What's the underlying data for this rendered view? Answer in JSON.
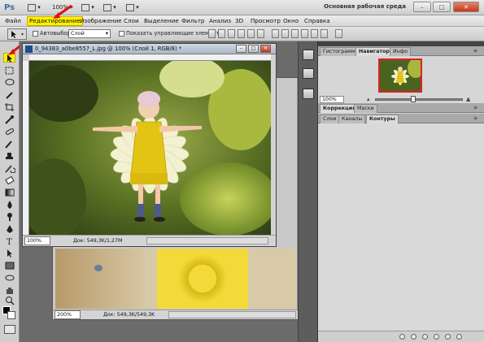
{
  "app": {
    "logo": "Ps",
    "zoom_top": "100%",
    "workspace": "Основная рабочая среда",
    "window_controls": [
      "–",
      "□",
      "✕"
    ]
  },
  "menu": [
    {
      "label": "Файл",
      "active": false
    },
    {
      "label": "Редактирование",
      "active": true
    },
    {
      "label": "Изображение",
      "active": false
    },
    {
      "label": "Слои",
      "active": false
    },
    {
      "label": "Выделение",
      "active": false
    },
    {
      "label": "Фильтр",
      "active": false
    },
    {
      "label": "Анализ",
      "active": false
    },
    {
      "label": "3D",
      "active": false
    },
    {
      "label": "Просмотр",
      "active": false
    },
    {
      "label": "Окно",
      "active": false
    },
    {
      "label": "Справка",
      "active": false
    }
  ],
  "options": {
    "autoselect_label": "Автовыбор:",
    "autoselect_value": "Слой",
    "show_controls_label": "Показать управляющие элементы"
  },
  "doc1": {
    "title": "0_94383_a0be8557_L.jpg @ 100% (Слой 1, RGB/8) *",
    "zoom": "100%",
    "info": "Док: 549,3K/1,27M"
  },
  "doc2": {
    "zoom": "200%",
    "info": "Док: 549,3K/549,3K"
  },
  "panels": {
    "tabs_top": [
      "Гистограмма",
      "Навигатор",
      "Инфо"
    ],
    "tabs_top_active": 1,
    "nav_zoom": "100%",
    "tabs_mid": [
      "Коррекция",
      "Маски"
    ],
    "tabs_bottom": [
      "Слои",
      "Каналы",
      "Контуры"
    ],
    "tabs_bottom_active": 2
  },
  "colors": {
    "menu_highlight": "#fff200",
    "annotation_arrow": "#e01010",
    "panel_bg": "#d0d0d0"
  }
}
